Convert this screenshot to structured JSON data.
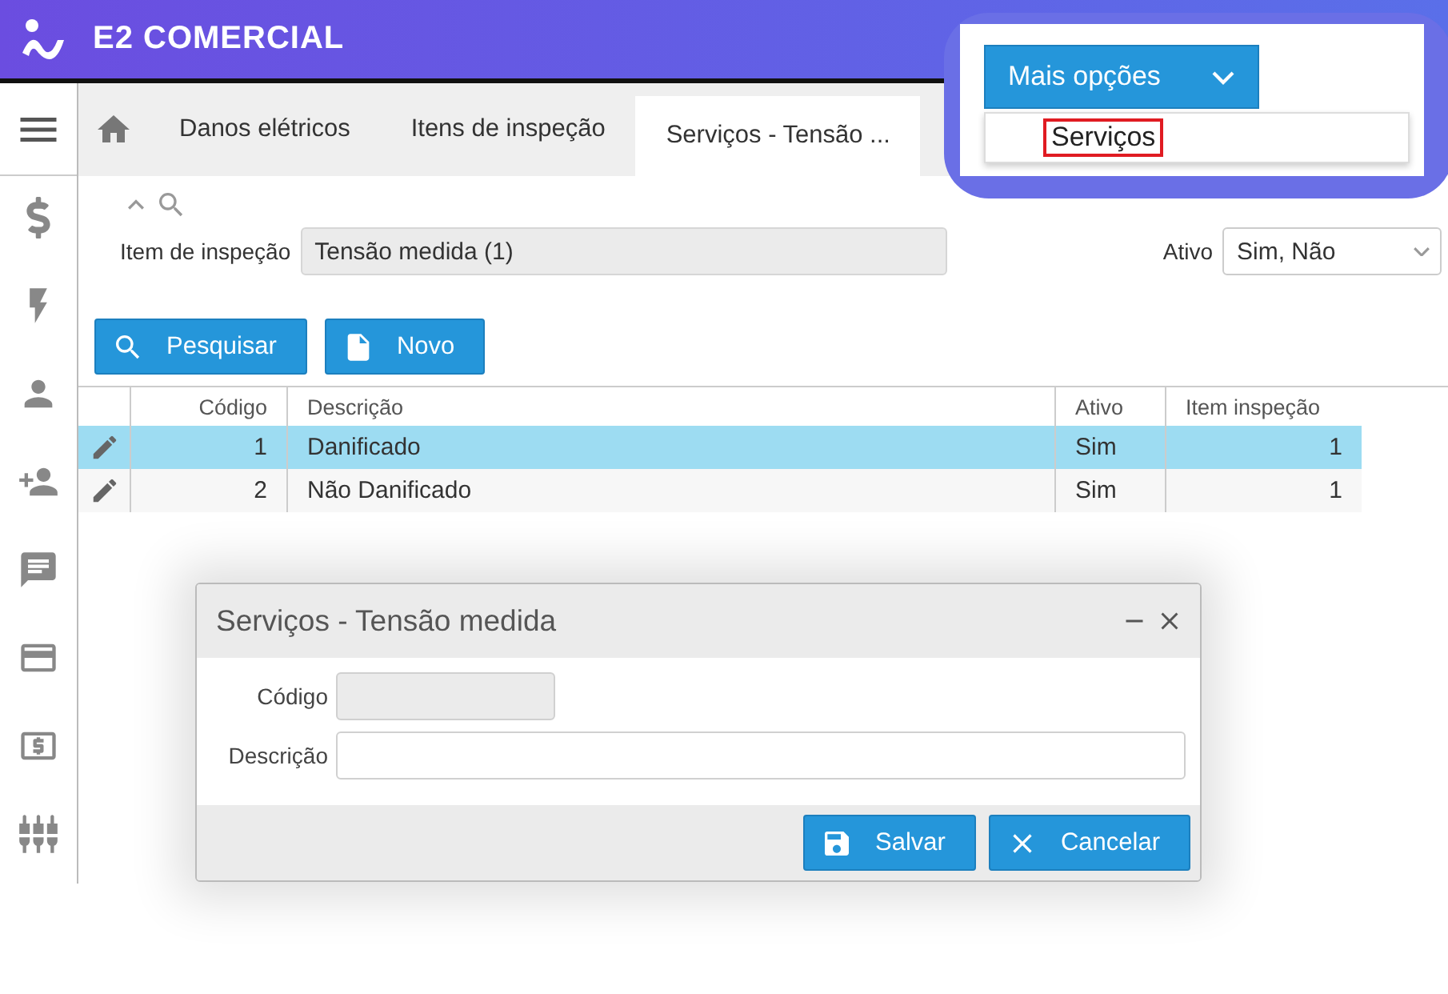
{
  "header": {
    "app_name": "E2 COMERCIAL"
  },
  "tabs": [
    {
      "label": "Danos elétricos",
      "selected": false
    },
    {
      "label": "Itens de inspeção",
      "selected": false
    },
    {
      "label": "Serviços - Tensão ...",
      "selected": true
    }
  ],
  "callout": {
    "button": "Mais opções",
    "menu_item": "Serviços"
  },
  "filter": {
    "item_label": "Item de inspeção",
    "item_value": "Tensão medida (1)",
    "active_label": "Ativo",
    "active_value": "Sim, Não"
  },
  "toolbar": [
    {
      "kind": "search",
      "label": "Pesquisar"
    },
    {
      "kind": "new",
      "label": "Novo"
    }
  ],
  "table": {
    "columns": [
      "Código",
      "Descrição",
      "Ativo",
      "Item inspeção"
    ],
    "rows": [
      {
        "selected": true,
        "cells": [
          "1",
          "Danificado",
          "Sim",
          "1"
        ]
      },
      {
        "selected": false,
        "cells": [
          "2",
          "Não Danificado",
          "Sim",
          "1"
        ]
      }
    ]
  },
  "dialog": {
    "title": "Serviços - Tensão medida",
    "fields": [
      {
        "label": "Código",
        "disabled": true
      },
      {
        "label": "Descrição",
        "disabled": false
      }
    ],
    "buttons": [
      {
        "kind": "save",
        "label": "Salvar"
      },
      {
        "kind": "cancel",
        "label": "Cancelar"
      }
    ]
  }
}
